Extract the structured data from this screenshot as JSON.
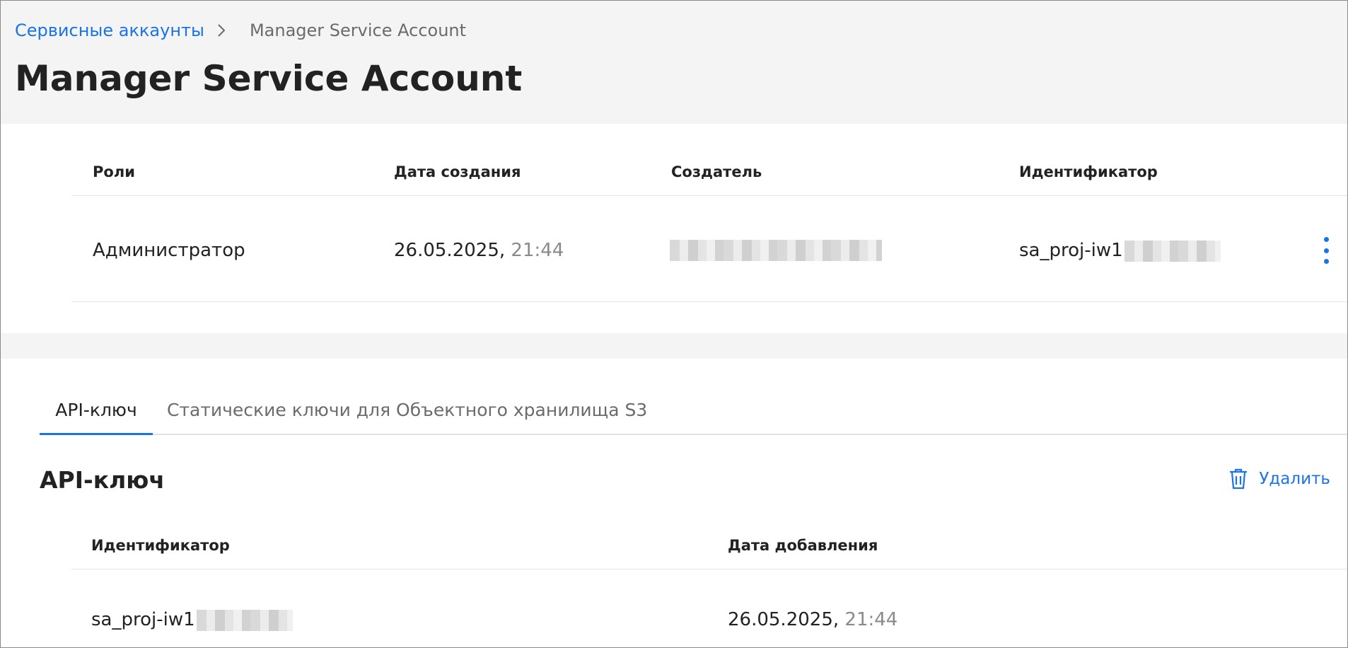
{
  "breadcrumb": {
    "parent": "Сервисные аккаунты",
    "current": "Manager Service Account"
  },
  "page": {
    "title": "Manager Service Account"
  },
  "info_table": {
    "headers": [
      "Роли",
      "Дата создания",
      "Создатель",
      "Идентификатор"
    ],
    "row": {
      "role": "Администратор",
      "created_date": "26.05.2025,",
      "created_time": "21:44",
      "identifier": "sa_proj-iw1"
    }
  },
  "tabs": [
    {
      "label": "API-ключ",
      "active": true
    },
    {
      "label": "Статические ключи для Объектного хранилища S3",
      "active": false
    }
  ],
  "api_key_section": {
    "title": "API-ключ",
    "delete_label": "Удалить",
    "headers": [
      "Идентификатор",
      "Дата добавления"
    ],
    "row": {
      "identifier": "sa_proj-iw1",
      "added_date": "26.05.2025,",
      "added_time": "21:44"
    }
  },
  "colors": {
    "accent": "#1a73e8",
    "header_bg": "#f4f4f4",
    "muted_text": "#8a8a8a"
  },
  "icons": [
    "chevron-right-icon",
    "more-vertical-icon",
    "trash-icon"
  ]
}
